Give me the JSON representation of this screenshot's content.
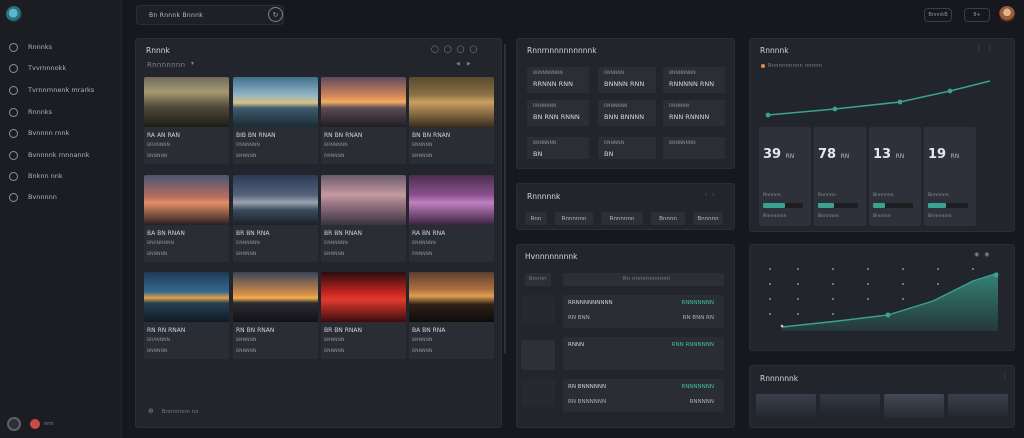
{
  "sidebar": {
    "items": [
      {
        "label": "Rnnnks",
        "icon": "home-icon"
      },
      {
        "label": "Tvvrnnnokk",
        "icon": "grid-icon"
      },
      {
        "label": "Tvrnnrnnenk mrarks",
        "icon": "target-icon"
      },
      {
        "label": "Rnnnks",
        "icon": "clock-icon"
      },
      {
        "label": "Bvnnnn rnnk",
        "icon": "user-icon"
      },
      {
        "label": "Bvnnnnk rnnnannk",
        "icon": "settings-icon"
      },
      {
        "label": "Bnknn nnk",
        "icon": "power-icon"
      },
      {
        "label": "Bvnnnnn",
        "icon": "shield-icon"
      }
    ],
    "bottom_label": "nnn"
  },
  "topbar": {
    "search_text": "Bn  Rnnnk  Bnnnk",
    "pill1": "BnnnkB",
    "pill2": "8+",
    "accent": "#3aa290"
  },
  "gallery": {
    "title": "Rnnnk",
    "filter": "Rnnnnnnn",
    "tiles": [
      {
        "t1": "RA  AN  RAN",
        "t2": "BRANNNN",
        "t3": "BNNNNN"
      },
      {
        "t1": "BIB  BN  RNAN",
        "t2": "RNNNNNN",
        "t3": "BNNNNN"
      },
      {
        "t1": "RN  BN  RNAN",
        "t2": "BRNNNNN",
        "t3": "RNNNNN"
      },
      {
        "t1": "BN  BN  RNAN",
        "t2": "BNNNNN",
        "t3": "BNNNNN"
      },
      {
        "t1": "BA  BN  RNAN",
        "t2": "BNANNNNN",
        "t3": "BNNNNN"
      },
      {
        "t1": "BR  BN  RNA",
        "t2": "RNNNNNN",
        "t3": "BNNNNN"
      },
      {
        "t1": "BR  BN  RNAN",
        "t2": "RNNNNNN",
        "t3": "BNNNNN"
      },
      {
        "t1": "RA  BN  RNA",
        "t2": "BNNNNNN",
        "t3": "RNNNNN"
      },
      {
        "t1": "RN  RN  RNAN",
        "t2": "BRANNNN",
        "t3": "BNNNNN"
      },
      {
        "t1": "RN  BN  RNAN",
        "t2": "BNNNNN",
        "t3": "BNNNNN"
      },
      {
        "t1": "BR  BN  RNAN",
        "t2": "BNNNNN",
        "t3": "BNNNNN"
      },
      {
        "t1": "BA  BN  RNA",
        "t2": "BNNNNN",
        "t3": "BNNNNN"
      }
    ],
    "footer": "Bnnnnnnn  nn"
  },
  "stats_panel": {
    "title": "Rnnrnnnnnnnnnnk",
    "cards": [
      {
        "a": "BRNNNNNNN",
        "b": "RRNNN  RNN"
      },
      {
        "a": "RNNNNN",
        "b": "BNNNN  RNN"
      },
      {
        "a": "BNNNNNNN",
        "b": "RNNNNN  RNN"
      },
      {
        "a": "RNNNNNN",
        "b": "BN  RNN  RNNN"
      },
      {
        "a": "RNNNNNN",
        "b": "BNN  BNNNN"
      },
      {
        "a": "RNNNNN",
        "b": "RNN  RNNNN"
      },
      {
        "a": "BNNNNNN",
        "b": "BN"
      },
      {
        "a": "RNNNNN",
        "b": "BN"
      },
      {
        "a": "BNNNNNNN",
        "b": ""
      }
    ]
  },
  "filters_panel": {
    "title": "Rnnnnnk",
    "chips": [
      "Rnn",
      "Rnnnnnn",
      "Rnnnnnn",
      "Bnnnn",
      "Bnnnnn",
      "Bnnnn"
    ]
  },
  "list_panel": {
    "title": "Hvnnnnnnnnk",
    "search": "Rnnnn",
    "search_right": "Rn  nnnnnnnnnnn",
    "rows": [
      {
        "l1": "RRNNNNNNNNN",
        "l2": "RN  BNN",
        "r1": "RNNNNNNN",
        "r2": "RN  BNN  RN"
      },
      {
        "l1": "RNNN",
        "l2": "",
        "r1": "RNN  RNNNNNN",
        "r2": ""
      },
      {
        "l1": "RN  BNNNNNN",
        "l2": "RN  BNNNNNN",
        "r1": "RNNNNNNN",
        "r2": "RNNNNN"
      }
    ]
  },
  "metrics_panel": {
    "title": "Rnnnnk",
    "legend": "Rnnnnnnnnn  nnnnn",
    "kpis": [
      {
        "value": "39",
        "unit": "RN",
        "fill": 0.55,
        "sub": "Rnnnnnnn",
        "sub2": "Rnnnnn"
      },
      {
        "value": "78",
        "unit": "RN",
        "fill": 0.4,
        "sub": "Bnnnnnn",
        "sub2": "Rnnnnn"
      },
      {
        "value": "13",
        "unit": "RN",
        "fill": 0.3,
        "sub": "Bnnnnn",
        "sub2": "Bnnnnnn"
      },
      {
        "value": "19",
        "unit": "RN",
        "fill": 0.45,
        "sub": "Bnnnnnnn",
        "sub2": "Bnnnnnn"
      }
    ]
  },
  "area_panel": {
    "title": ""
  },
  "thumbs_panel": {
    "title": "Rnnnnnnk"
  }
}
